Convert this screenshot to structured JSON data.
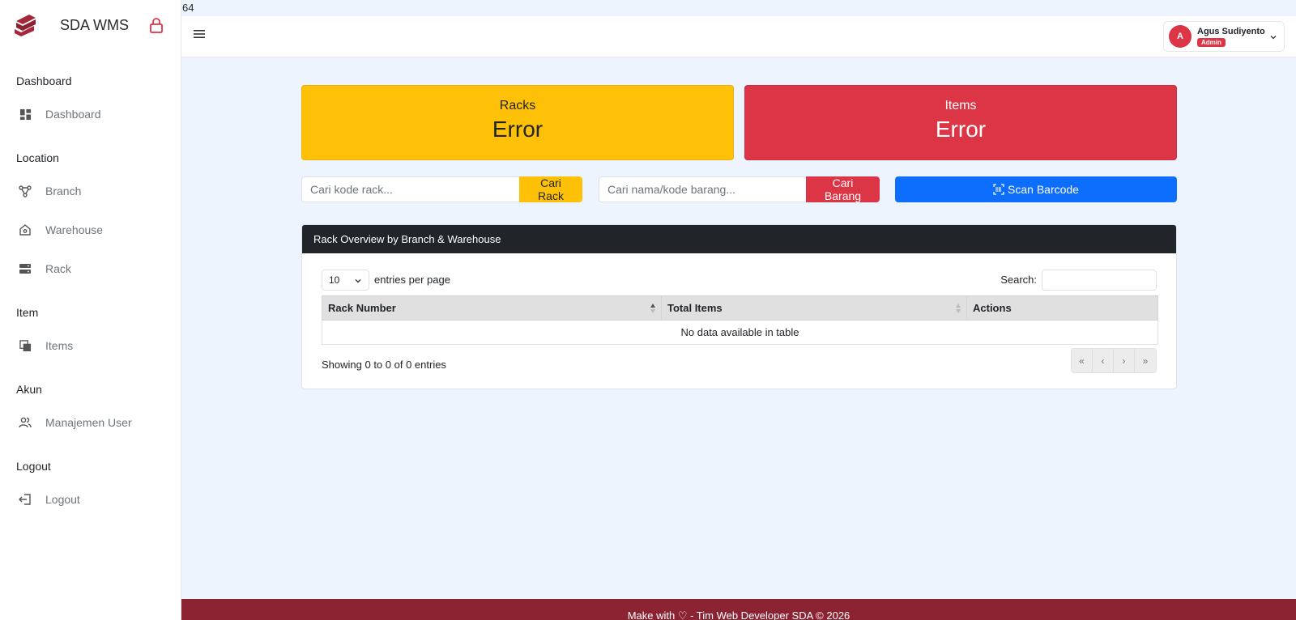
{
  "top_counter": "64",
  "brand": {
    "name": "SDA WMS"
  },
  "sidebar": {
    "sections": [
      {
        "title": "Dashboard",
        "items": [
          {
            "label": "Dashboard",
            "icon": "dashboard-icon"
          }
        ]
      },
      {
        "title": "Location",
        "items": [
          {
            "label": "Branch",
            "icon": "branch-icon"
          },
          {
            "label": "Warehouse",
            "icon": "warehouse-icon"
          },
          {
            "label": "Rack",
            "icon": "rack-icon"
          }
        ]
      },
      {
        "title": "Item",
        "items": [
          {
            "label": "Items",
            "icon": "items-icon"
          }
        ]
      },
      {
        "title": "Akun",
        "items": [
          {
            "label": "Manajemen User",
            "icon": "users-icon"
          }
        ]
      },
      {
        "title": "Logout",
        "items": [
          {
            "label": "Logout",
            "icon": "logout-icon"
          }
        ]
      }
    ]
  },
  "header": {
    "user": {
      "initial": "A",
      "name": "Agus Sudiyento",
      "role": "Admin"
    }
  },
  "stats": {
    "racks": {
      "title": "Racks",
      "value": "Error",
      "color": "#ffc107"
    },
    "items": {
      "title": "Items",
      "value": "Error",
      "color": "#dc3545"
    }
  },
  "search": {
    "rack_placeholder": "Cari kode rack...",
    "rack_button": "Cari Rack",
    "item_placeholder": "Cari nama/kode barang...",
    "item_button": "Cari Barang",
    "scan_button": "Scan Barcode"
  },
  "table_card": {
    "title": "Rack Overview by Branch & Warehouse",
    "length_value": "10",
    "length_label": "entries per page",
    "search_label": "Search:",
    "columns": [
      "Rack Number",
      "Total Items",
      "Actions"
    ],
    "empty_text": "No data available in table",
    "info": "Showing 0 to 0 of 0 entries",
    "pager": [
      "«",
      "‹",
      "›",
      "»"
    ]
  },
  "footer": {
    "text": "Make with ♡ - Tim Web Developer SDA © 2026"
  },
  "colors": {
    "accent": "#8b2332",
    "primary": "#0d6efd",
    "warning": "#ffc107",
    "danger": "#dc3545"
  }
}
